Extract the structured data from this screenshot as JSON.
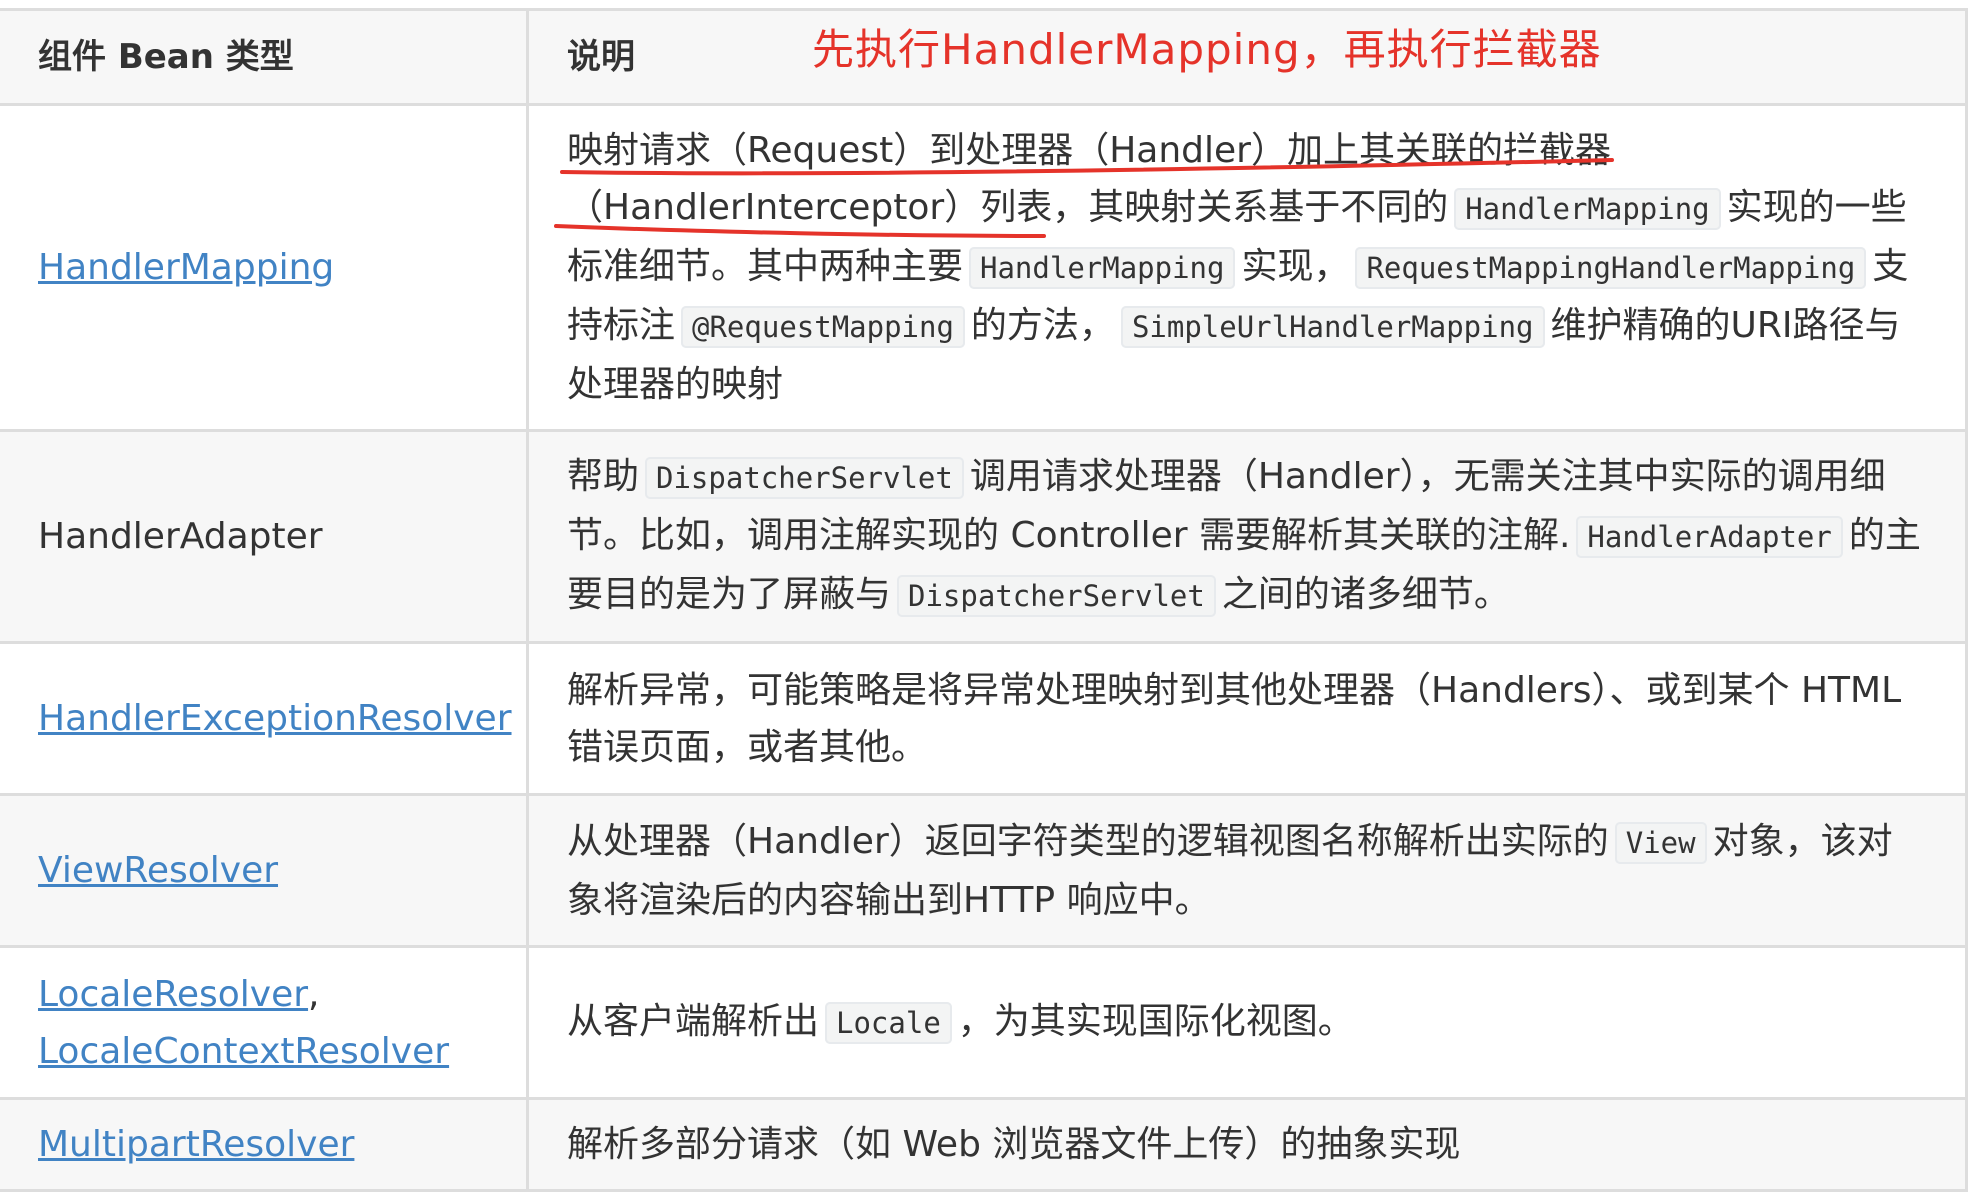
{
  "annotation": {
    "note": "先执行HandlerMapping，再执行拦截器",
    "color": "#e5332a"
  },
  "table": {
    "headers": {
      "type": "组件 Bean 类型",
      "desc": "说明"
    },
    "rows": [
      {
        "type": "HandlerMapping",
        "link": true,
        "desc": [
          {
            "t": "映射请求（Request）到处理器（Handler）加上其关联的拦截器（HandlerInterceptor）列表，其映射关系基于不同的"
          },
          {
            "c": "HandlerMapping"
          },
          {
            "t": "实现的一些标准细节。其中两种主要"
          },
          {
            "c": "HandlerMapping"
          },
          {
            "t": "实现，"
          },
          {
            "c": "RequestMappingHandlerMapping"
          },
          {
            "t": "支持标注"
          },
          {
            "c": "@RequestMapping"
          },
          {
            "t": "的方法，"
          },
          {
            "c": "SimpleUrlHandlerMapping"
          },
          {
            "t": "维护精确的URI路径与处理器的映射"
          }
        ]
      },
      {
        "type": "HandlerAdapter",
        "link": false,
        "desc": [
          {
            "t": "帮助"
          },
          {
            "c": "DispatcherServlet"
          },
          {
            "t": "调用请求处理器（Handler），无需关注其中实际的调用细节。比如，调用注解实现的 Controller 需要解析其关联的注解."
          },
          {
            "c": "HandlerAdapter"
          },
          {
            "t": "的主要目的是为了屏蔽与"
          },
          {
            "c": "DispatcherServlet"
          },
          {
            "t": "之间的诸多细节。"
          }
        ]
      },
      {
        "type": "HandlerExceptionResolver",
        "link": true,
        "desc": [
          {
            "t": "解析异常，可能策略是将异常处理映射到其他处理器（Handlers）、或到某个 HTML 错误页面，或者其他。"
          }
        ]
      },
      {
        "type": "ViewResolver",
        "link": true,
        "desc": [
          {
            "t": "从处理器（Handler）返回字符类型的逻辑视图名称解析出实际的"
          },
          {
            "c": "View"
          },
          {
            "t": "对象，该对象将渲染后的内容输出到HTTP 响应中。"
          }
        ]
      },
      {
        "type": "LocaleResolver, LocaleContextResolver",
        "link": true,
        "desc": [
          {
            "t": "从客户端解析出"
          },
          {
            "c": "Locale"
          },
          {
            "t": "，为其实现国际化视图。"
          }
        ]
      },
      {
        "type": "MultipartResolver",
        "link": true,
        "desc": [
          {
            "t": "解析多部分请求（如 Web 浏览器文件上传）的抽象实现"
          }
        ]
      }
    ]
  }
}
